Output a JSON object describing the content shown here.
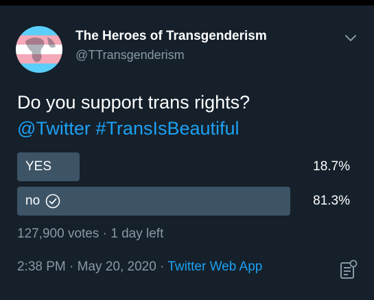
{
  "tweet": {
    "author": {
      "display_name": "The Heroes of Transgenderism",
      "handle": "@TTransgenderism",
      "avatar_icon": "trans-flag-globe-avatar"
    },
    "text_line1": "Do you support trans rights?",
    "mention": "@Twitter",
    "hashtag": "#TransIsBeautiful",
    "poll": {
      "options": [
        {
          "label": "YES",
          "percent_text": "18.7%",
          "percent": 18.7,
          "selected": false
        },
        {
          "label": "no",
          "percent_text": "81.3%",
          "percent": 81.3,
          "selected": true
        }
      ],
      "votes": "127,900 votes",
      "separator": "·",
      "time_left": "1 day left"
    },
    "timestamp": {
      "time": "2:38 PM",
      "sep": "·",
      "date": "May 20, 2020",
      "source": "Twitter Web App"
    }
  },
  "colors": {
    "background": "#15202b",
    "accent": "#1da1f2",
    "muted": "#8899a6",
    "poll_bar": "#3d5466"
  }
}
